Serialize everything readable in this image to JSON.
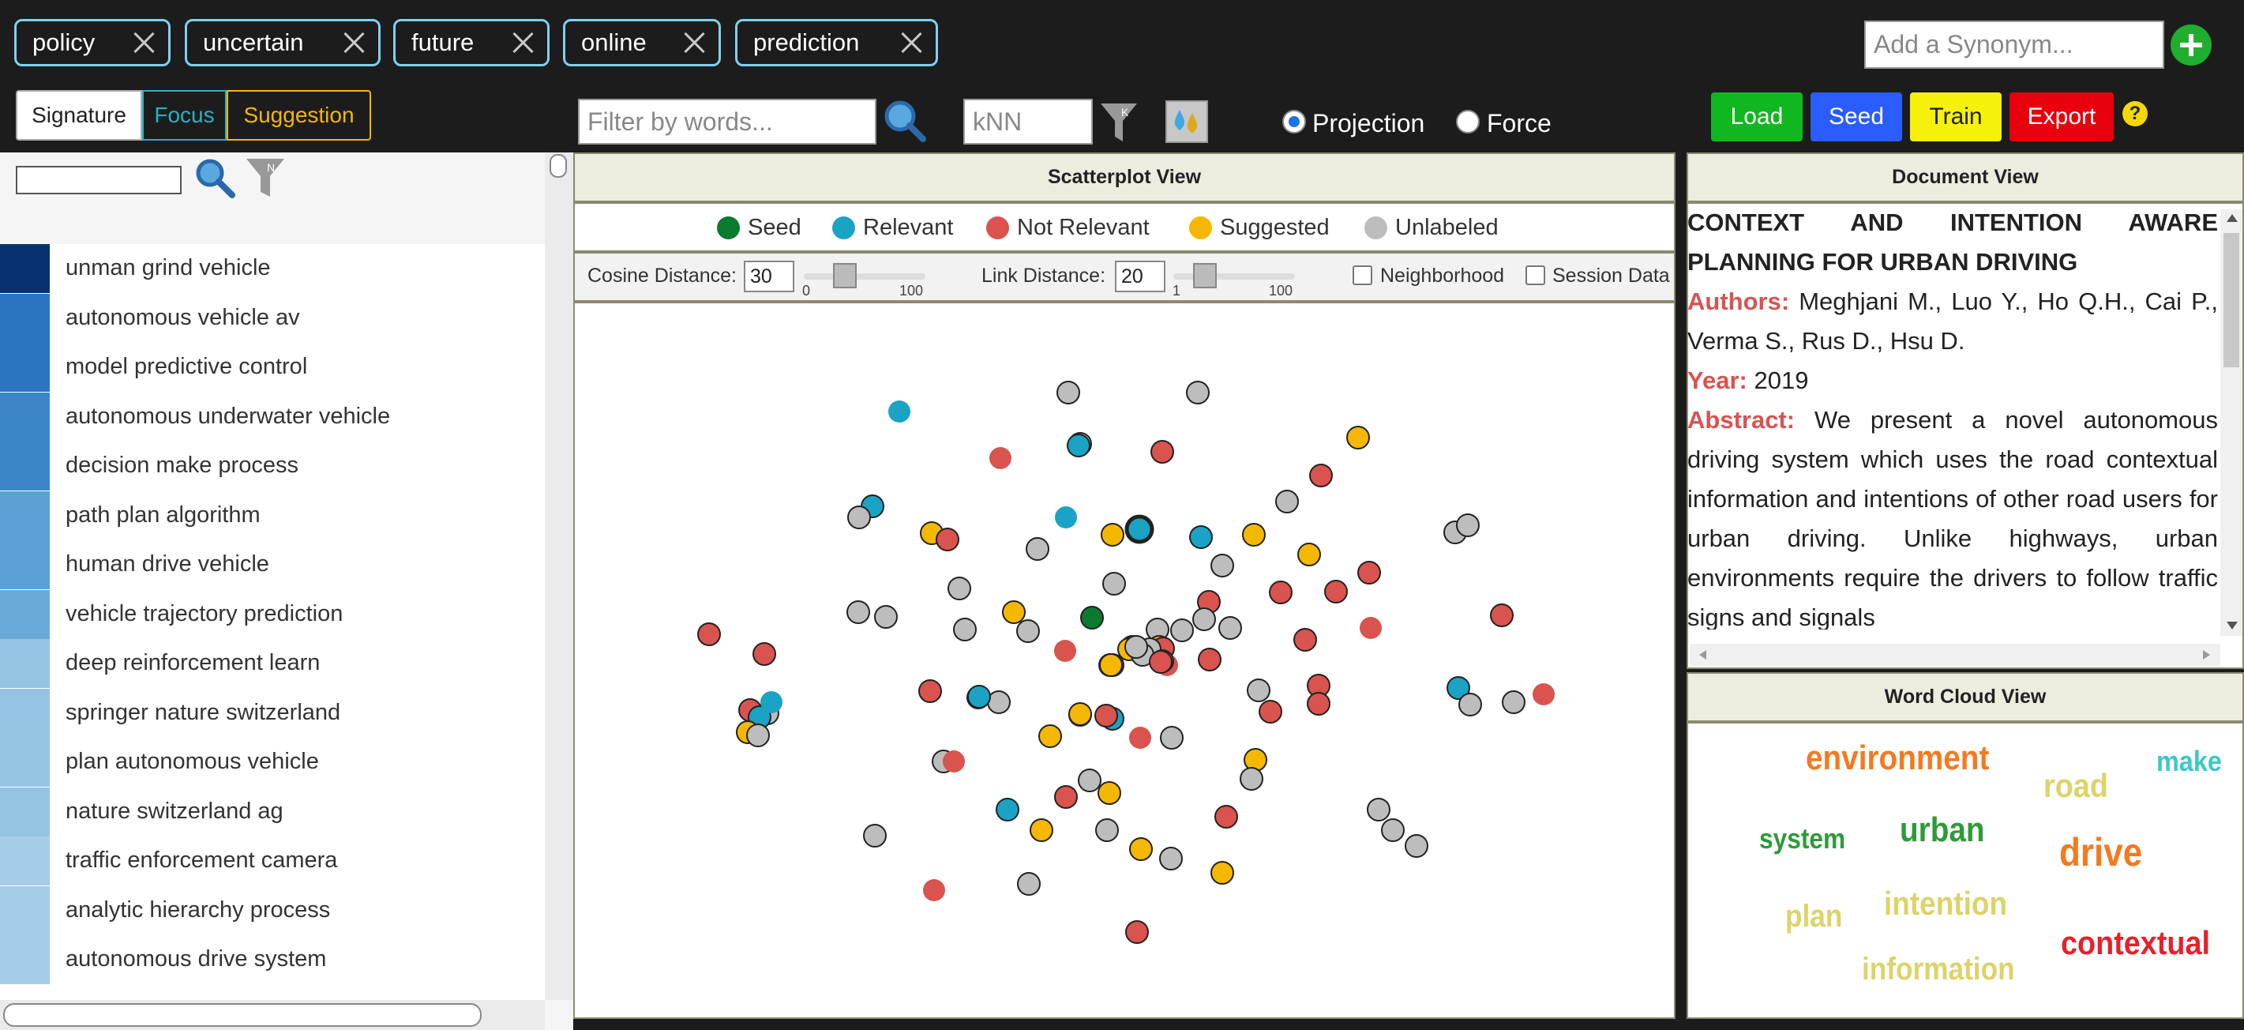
{
  "keywords": [
    "policy",
    "uncertain",
    "future",
    "online",
    "prediction"
  ],
  "synonym": {
    "placeholder": "Add a Synonym..."
  },
  "modes": [
    "Signature",
    "Focus",
    "Suggestion"
  ],
  "filter": {
    "placeholder": "Filter by words..."
  },
  "knn": {
    "placeholder": "kNN"
  },
  "layout_options": [
    "Projection",
    "Force"
  ],
  "layout_selected": "Projection",
  "actions": {
    "load": "Load",
    "seed": "Seed",
    "train": "Train",
    "export": "Export",
    "help": "?"
  },
  "action_colors": {
    "load": "#10b720",
    "seed": "#2a5cff",
    "train": "#f6f10a",
    "export": "#e8000c"
  },
  "left_panel": {
    "filter_icon_letter": "N",
    "terms": [
      {
        "label": "unman grind vehicle",
        "shade": "#08326e"
      },
      {
        "label": "autonomous vehicle av",
        "shade": "#2b75c0"
      },
      {
        "label": "model predictive control",
        "shade": "#2b75c0"
      },
      {
        "label": "autonomous underwater vehicle",
        "shade": "#3b86c8"
      },
      {
        "label": "decision make process",
        "shade": "#3b86c8"
      },
      {
        "label": "path plan algorithm",
        "shade": "#5aa0d4"
      },
      {
        "label": "human drive vehicle",
        "shade": "#5aa0d4"
      },
      {
        "label": "vehicle trajectory prediction",
        "shade": "#6aaad8"
      },
      {
        "label": "deep reinforcement learn",
        "shade": "#94c3e4"
      },
      {
        "label": "springer nature switzerland",
        "shade": "#94c3e4"
      },
      {
        "label": "plan autonomous vehicle",
        "shade": "#94c3e4"
      },
      {
        "label": "nature switzerland ag",
        "shade": "#94c3e4"
      },
      {
        "label": "traffic enforcement camera",
        "shade": "#a6cde8"
      },
      {
        "label": "analytic hierarchy process",
        "shade": "#a6cde8"
      },
      {
        "label": "autonomous drive system",
        "shade": "#a6cde8"
      }
    ]
  },
  "scatter": {
    "title": "Scatterplot View",
    "legend": [
      {
        "label": "Seed",
        "color": "#0a7a2e"
      },
      {
        "label": "Relevant",
        "color": "#1aa3c4"
      },
      {
        "label": "Not Relevant",
        "color": "#d9534f"
      },
      {
        "label": "Suggested",
        "color": "#f5b800"
      },
      {
        "label": "Unlabeled",
        "color": "#bdbdbd"
      }
    ],
    "cosine_label": "Cosine Distance:",
    "cosine_value": "30",
    "cosine_level": 0.3,
    "link_label": "Link Distance:",
    "link_value": "20",
    "link_level": 0.2,
    "range_min_a": "0",
    "range_max_a": "100",
    "range_min_b": "1",
    "range_max_b": "100",
    "neighborhood": "Neighborhood",
    "session": "Session Data"
  },
  "document": {
    "title_header": "Document View",
    "title": "CONTEXT AND INTENTION AWARE PLANNING FOR URBAN DRIVING",
    "authors_label": "Authors:",
    "authors": "Meghjani M., Luo Y., Ho Q.H., Cai P., Verma S., Rus D., Hsu D.",
    "year_label": "Year:",
    "year": "2019",
    "abstract_label": "Abstract:",
    "abstract": "We present a novel autonomous driving system which uses the road contextual information and intentions of other road users for urban driving. Unlike highways, urban environments require the drivers to follow traffic signs and signals"
  },
  "wordcloud": {
    "title": "Word Cloud View",
    "words": [
      {
        "text": "environment",
        "color": "#f47a1f"
      },
      {
        "text": "make",
        "color": "#3cc8c8"
      },
      {
        "text": "road",
        "color": "#dcd36a"
      },
      {
        "text": "system",
        "color": "#2e9a3a"
      },
      {
        "text": "urban",
        "color": "#2e9a3a"
      },
      {
        "text": "drive",
        "color": "#f47a1f"
      },
      {
        "text": "plan",
        "color": "#dcd36a"
      },
      {
        "text": "intention",
        "color": "#dcd36a"
      },
      {
        "text": "contextual",
        "color": "#e8202a"
      },
      {
        "text": "information",
        "color": "#dcd36a"
      }
    ]
  }
}
